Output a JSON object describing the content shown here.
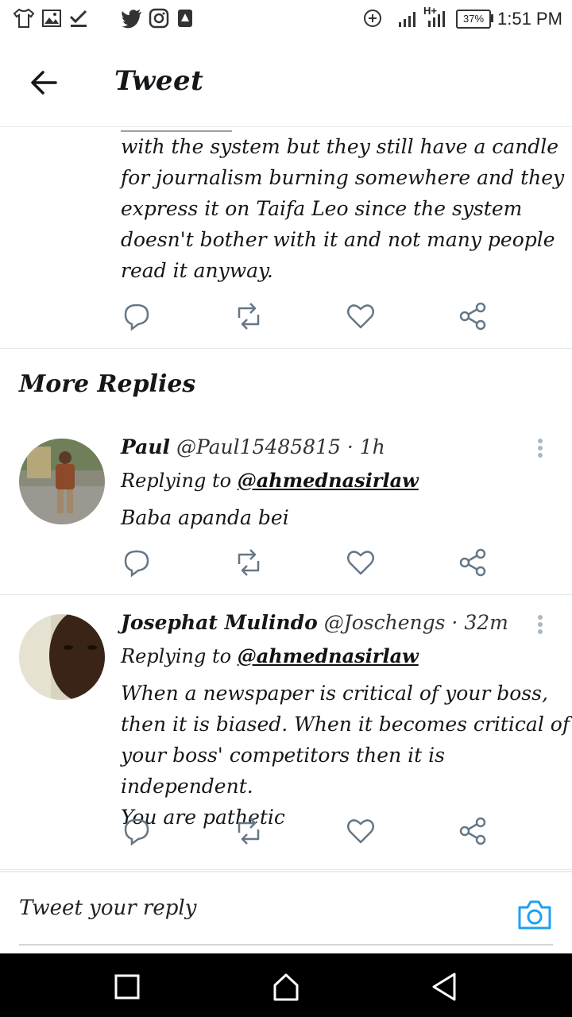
{
  "status_bar": {
    "battery": "37%",
    "time": "1:51 PM",
    "network_label": "H+"
  },
  "header": {
    "title": "Tweet"
  },
  "main_tweet": {
    "lines": [
      "with the system but they still have a candle",
      "for journalism burning somewhere and they",
      "express it on Taifa Leo since the system",
      "doesn't bother with it and not many people",
      "read it anyway."
    ]
  },
  "more_replies": {
    "title": "More Replies"
  },
  "replies": [
    {
      "name": "Paul",
      "handle": "@Paul15485815",
      "time": "1h",
      "replying_label": "Replying to",
      "replying_to": "@ahmednasirlaw",
      "lines": [
        "Baba apanda bei"
      ]
    },
    {
      "name": "Josephat Mulindo",
      "handle": "@Joschengs",
      "time": "32m",
      "replying_label": "Replying to",
      "replying_to": "@ahmednasirlaw",
      "lines": [
        "When a newspaper is critical of your boss,",
        "then it is biased. When it becomes critical of",
        "your boss' competitors then it is independent.",
        "You are pathetic"
      ]
    }
  ],
  "reply_bar": {
    "placeholder": "Tweet your reply"
  },
  "icons": {
    "action_color": "#657786",
    "camera_color": "#1da1f2"
  }
}
